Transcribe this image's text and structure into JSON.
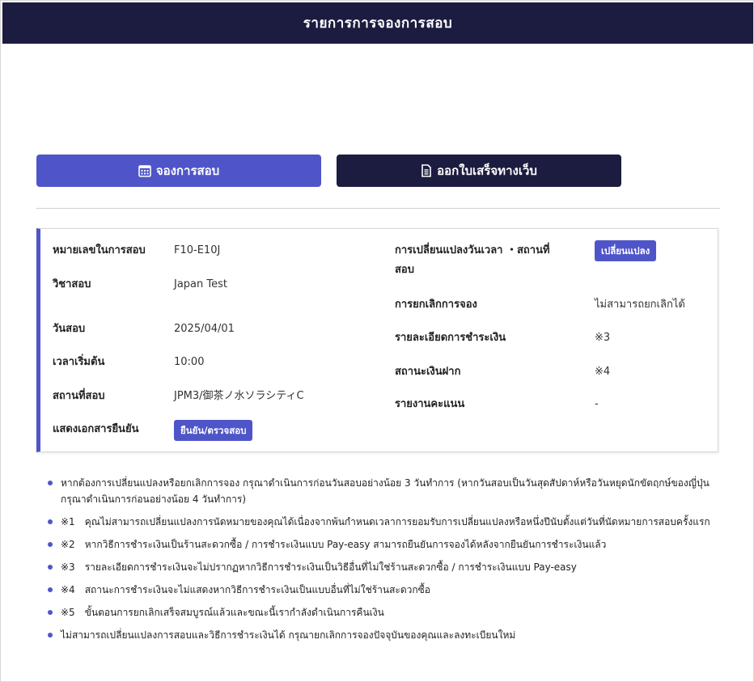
{
  "header": {
    "title": "รายการการจองการสอบ"
  },
  "actions": {
    "reserve_label": "จองการสอบ",
    "reserve_icon": "calendar-icon",
    "receipt_label": "ออกใบเสร็จทางเว็บ",
    "receipt_icon": "document-icon"
  },
  "details": {
    "left": {
      "exam_id_label": "หมายเลขในการสอบ",
      "exam_id_value": "F10-E10J",
      "subject_label": "วิชาสอบ",
      "subject_value": "Japan Test",
      "date_label": "วันสอบ",
      "date_value": "2025/04/01",
      "start_label": "เวลาเริ่มต้น",
      "start_value": "10:00",
      "venue_label": "สถานที่สอบ",
      "venue_value": "JPM3/御茶ノ水ソラシティC",
      "doc_label": "แสดงเอกสารยืนยัน",
      "doc_button": "ยืนยัน/ตรวจสอบ"
    },
    "right": {
      "change_label_line1": "การเปลี่ยนแปลงวันเวลา ・สถานที่",
      "change_label_line2": "สอบ",
      "change_button": "เปลี่ยนแปลง",
      "cancel_label": "การยกเลิกการจอง",
      "cancel_value": "ไม่สามารถยกเลิกได้",
      "payment_label": "รายละเอียดการชำระเงิน",
      "payment_value": "※3",
      "deposit_label": "สถานะเงินฝาก",
      "deposit_value": "※4",
      "score_label": "รายงานคะแนน",
      "score_value": "-"
    }
  },
  "notes": [
    "หากต้องการเปลี่ยนแปลงหรือยกเลิกการจอง กรุณาดำเนินการก่อนวันสอบอย่างน้อย 3 วันทำการ (หากวันสอบเป็นวันสุดสัปดาห์หรือวันหยุดนักขัตฤกษ์ของญี่ปุ่น กรุณาดำเนินการก่อนอย่างน้อย 4 วันทำการ)",
    "※1　คุณไม่สามารถเปลี่ยนแปลงการนัดหมายของคุณได้เนื่องจากพ้นกำหนดเวลาการยอมรับการเปลี่ยนแปลงหรือหนึ่งปีนับตั้งแต่วันที่นัดหมายการสอบครั้งแรก",
    "※2　หากวิธีการชำระเงินเป็นร้านสะดวกซื้อ / การชำระเงินแบบ Pay-easy สามารถยืนยันการจองได้หลังจากยืนยันการชำระเงินแล้ว",
    "※3　รายละเอียดการชำระเงินจะไม่ปรากฏหากวิธีการชำระเงินเป็นวิธีอื่นที่ไม่ใช่ร้านสะดวกซื้อ / การชำระเงินแบบ Pay-easy",
    "※4　สถานะการชำระเงินจะไม่แสดงหากวิธีการชำระเงินเป็นแบบอื่นที่ไม่ใช่ร้านสะดวกซื้อ",
    "※5　ขั้นตอนการยกเลิกเสร็จสมบูรณ์แล้วและขณะนี้เรากำลังดำเนินการคืนเงิน",
    "ไม่สามารถเปลี่ยนแปลงการสอบและวิธีการชำระเงินได้ กรุณายกเลิกการจองปัจจุบันของคุณและลงทะเบียนใหม่"
  ]
}
